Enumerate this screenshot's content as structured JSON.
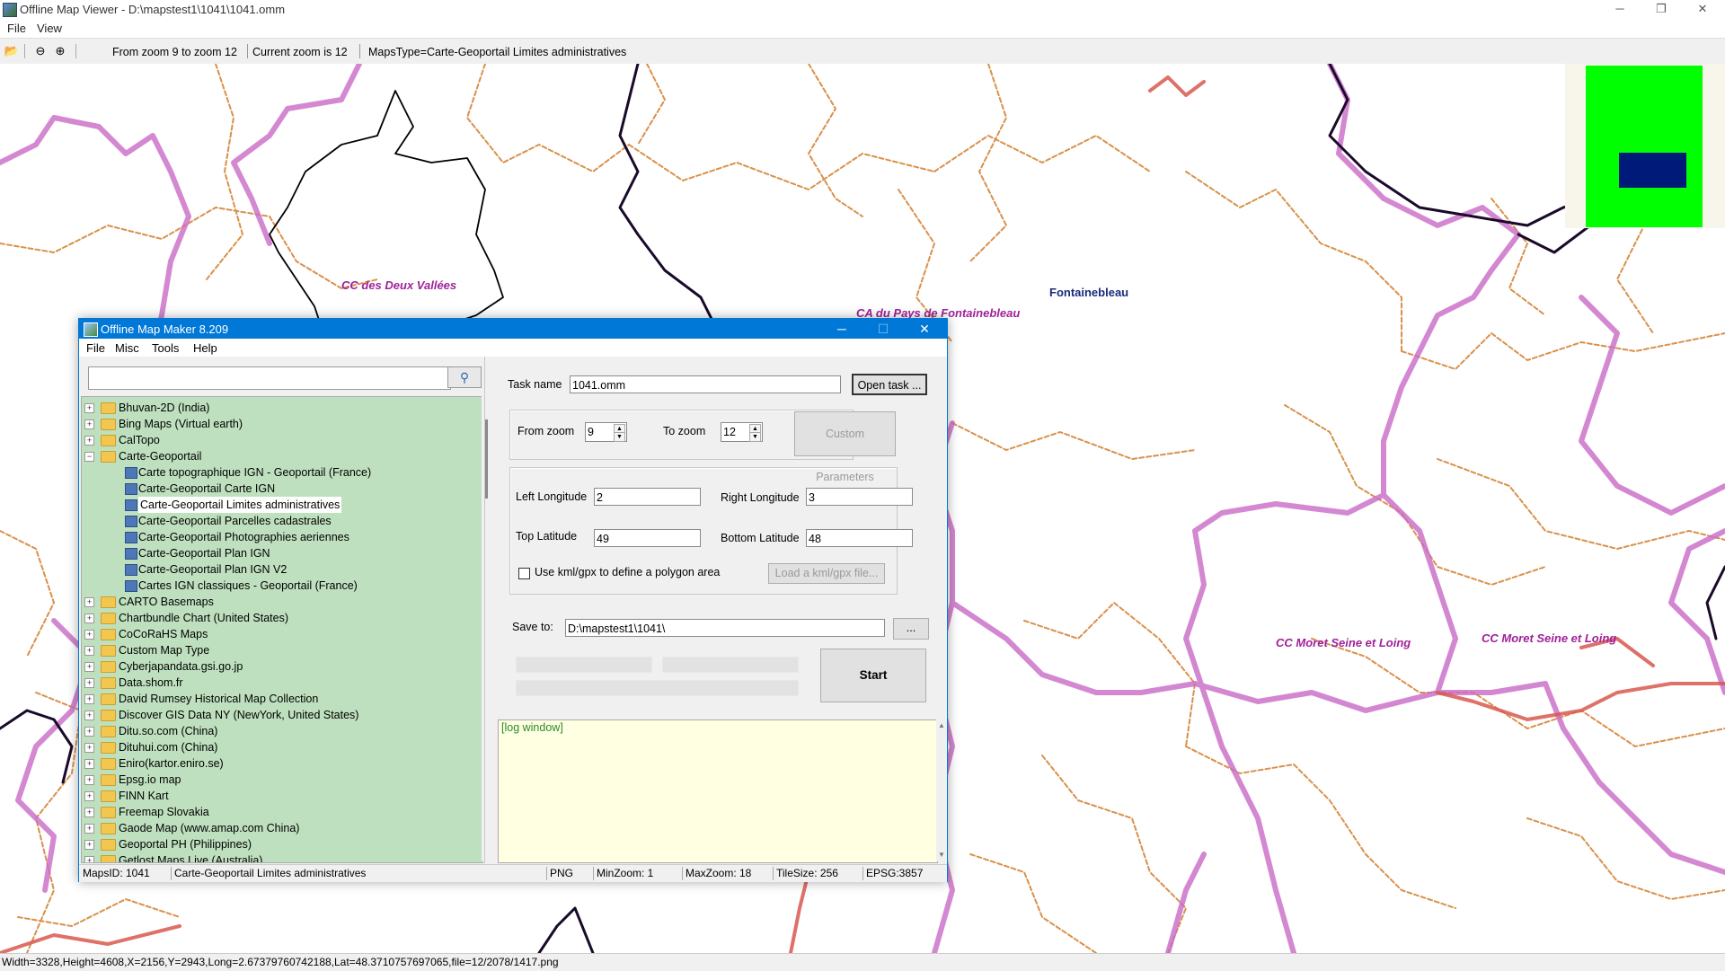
{
  "window": {
    "title": "Offline Map Viewer - D:\\mapstest1\\1041\\1041.omm",
    "minimize": "─",
    "maximize": "❐",
    "close": "✕"
  },
  "menu": [
    "File",
    "View"
  ],
  "toolbar": {
    "zoom_range": "From zoom 9 to zoom 12",
    "current_zoom": "Current zoom is 12",
    "maps_type": "MapsType=Carte-Geoportail Limites administratives"
  },
  "map": {
    "labels": {
      "cc_deux_vallees": "CC des Deux Vallées",
      "ca_fontainebleau": "CA du Pays de Fontainebleau",
      "fontainebleau": "Fontainebleau",
      "cc_moret_1": "CC Moret Seine et Loing",
      "cc_moret_2": "CC Moret Seine et Loing"
    },
    "colors": {
      "commune_boundary": "#d9914c",
      "intercommunal_boundary": "#c96ac6",
      "departmental_boundary": "#1a0a2a",
      "region_boundary": "#d8584e",
      "label_purple": "#a0219a",
      "label_blue": "#1a2a7a",
      "minimap_green": "#00ff00",
      "minimap_box": "#001a7a"
    }
  },
  "statusbar": "Width=3328,Height=4608,X=2156,Y=2943,Long=2.67379760742188,Lat=48.3710757697065,file=12/2078/1417.png",
  "dialog": {
    "title": "Offline Map Maker 8.209",
    "menu": [
      "File",
      "Misc",
      "Tools",
      "Help"
    ],
    "search_value": "",
    "tree": [
      {
        "label": "Bhuvan-2D (India)",
        "type": "folder",
        "expanded": false
      },
      {
        "label": "Bing Maps (Virtual earth)",
        "type": "folder",
        "expanded": false
      },
      {
        "label": "CalTopo",
        "type": "folder",
        "expanded": false
      },
      {
        "label": "Carte-Geoportail",
        "type": "folder",
        "expanded": true
      },
      {
        "label": "Carte topographique IGN - Geoportail (France)",
        "type": "map",
        "child": true
      },
      {
        "label": "Carte-Geoportail Carte IGN",
        "type": "map",
        "child": true
      },
      {
        "label": "Carte-Geoportail Limites administratives",
        "type": "map",
        "child": true,
        "selected": true
      },
      {
        "label": "Carte-Geoportail Parcelles cadastrales",
        "type": "map",
        "child": true
      },
      {
        "label": "Carte-Geoportail Photographies aeriennes",
        "type": "map",
        "child": true
      },
      {
        "label": "Carte-Geoportail Plan IGN",
        "type": "map",
        "child": true
      },
      {
        "label": "Carte-Geoportail Plan IGN V2",
        "type": "map",
        "child": true
      },
      {
        "label": "Cartes IGN classiques - Geoportail (France)",
        "type": "map",
        "child": true
      },
      {
        "label": "CARTO Basemaps",
        "type": "folder",
        "expanded": false
      },
      {
        "label": "Chartbundle Chart (United States)",
        "type": "folder",
        "expanded": false
      },
      {
        "label": "CoCoRaHS Maps",
        "type": "folder",
        "expanded": false
      },
      {
        "label": "Custom Map Type",
        "type": "folder",
        "expanded": false
      },
      {
        "label": "Cyberjapandata.gsi.go.jp",
        "type": "folder",
        "expanded": false
      },
      {
        "label": "Data.shom.fr",
        "type": "folder",
        "expanded": false
      },
      {
        "label": "David Rumsey Historical Map Collection",
        "type": "folder",
        "expanded": false
      },
      {
        "label": "Discover GIS Data NY (NewYork, United States)",
        "type": "folder",
        "expanded": false
      },
      {
        "label": "Ditu.so.com (China)",
        "type": "folder",
        "expanded": false
      },
      {
        "label": "Dituhui.com (China)",
        "type": "folder",
        "expanded": false
      },
      {
        "label": "Eniro(kartor.eniro.se)",
        "type": "folder",
        "expanded": false
      },
      {
        "label": "Epsg.io map",
        "type": "folder",
        "expanded": false
      },
      {
        "label": "FINN Kart",
        "type": "folder",
        "expanded": false
      },
      {
        "label": "Freemap Slovakia",
        "type": "folder",
        "expanded": false
      },
      {
        "label": "Gaode Map (www.amap.com China)",
        "type": "folder",
        "expanded": false
      },
      {
        "label": "Geoportal PH (Philippines)",
        "type": "folder",
        "expanded": false
      },
      {
        "label": "Getlost Maps Live (Australia)",
        "type": "folder",
        "expanded": false
      }
    ],
    "task_name_label": "Task name",
    "task_name_value": "1041.omm",
    "open_task": "Open task ...",
    "from_zoom_label": "From zoom",
    "from_zoom_value": "9",
    "to_zoom_label": "To zoom",
    "to_zoom_value": "12",
    "custom_parameters": "Custom Parameters",
    "left_longitude_label": "Left Longitude",
    "left_longitude_value": "2",
    "right_longitude_label": "Right Longitude",
    "right_longitude_value": "3",
    "top_latitude_label": "Top Latitude",
    "top_latitude_value": "49",
    "bottom_latitude_label": "Bottom Latitude",
    "bottom_latitude_value": "48",
    "use_kml_label": "Use kml/gpx to define a polygon area",
    "use_kml_checked": false,
    "load_kml": "Load a kml/gpx file...",
    "save_to_label": "Save to:",
    "save_to_value": "D:\\mapstest1\\1041\\",
    "browse": "...",
    "start": "Start",
    "log": "[log window]",
    "status": {
      "maps_id": "MapsID: 1041",
      "map_name": "Carte-Geoportail Limites administratives",
      "format": "PNG",
      "min_zoom": "MinZoom: 1",
      "max_zoom": "MaxZoom: 18",
      "tile_size": "TileSize: 256",
      "epsg": "EPSG:3857"
    }
  }
}
